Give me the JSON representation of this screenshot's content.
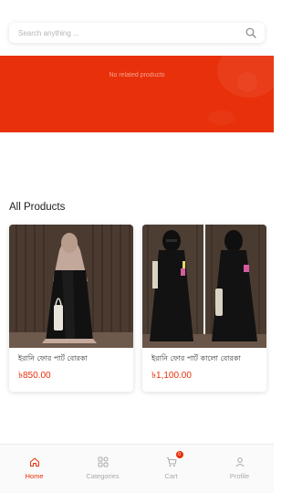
{
  "search": {
    "placeholder": "Search anything ..."
  },
  "banner": {
    "message": "No related products"
  },
  "products_section": {
    "title": "All Products",
    "items": [
      {
        "name": "ইরানি ফোর পার্ট বোরকা",
        "price": "৳850.00"
      },
      {
        "name": "ইরানি ফোর পার্ট কালো বোরকা",
        "price": "৳1,100.00"
      }
    ]
  },
  "bottom_nav": {
    "items": [
      {
        "label": "Home",
        "icon": "home-icon",
        "active": true
      },
      {
        "label": "Categories",
        "icon": "categories-icon"
      },
      {
        "label": "Cart",
        "icon": "cart-icon",
        "badge": "0"
      },
      {
        "label": "Profile",
        "icon": "profile-icon"
      }
    ]
  },
  "colors": {
    "accent": "#e8300a",
    "banner": "#e8300a",
    "nav_inactive": "#aaaaaa"
  }
}
